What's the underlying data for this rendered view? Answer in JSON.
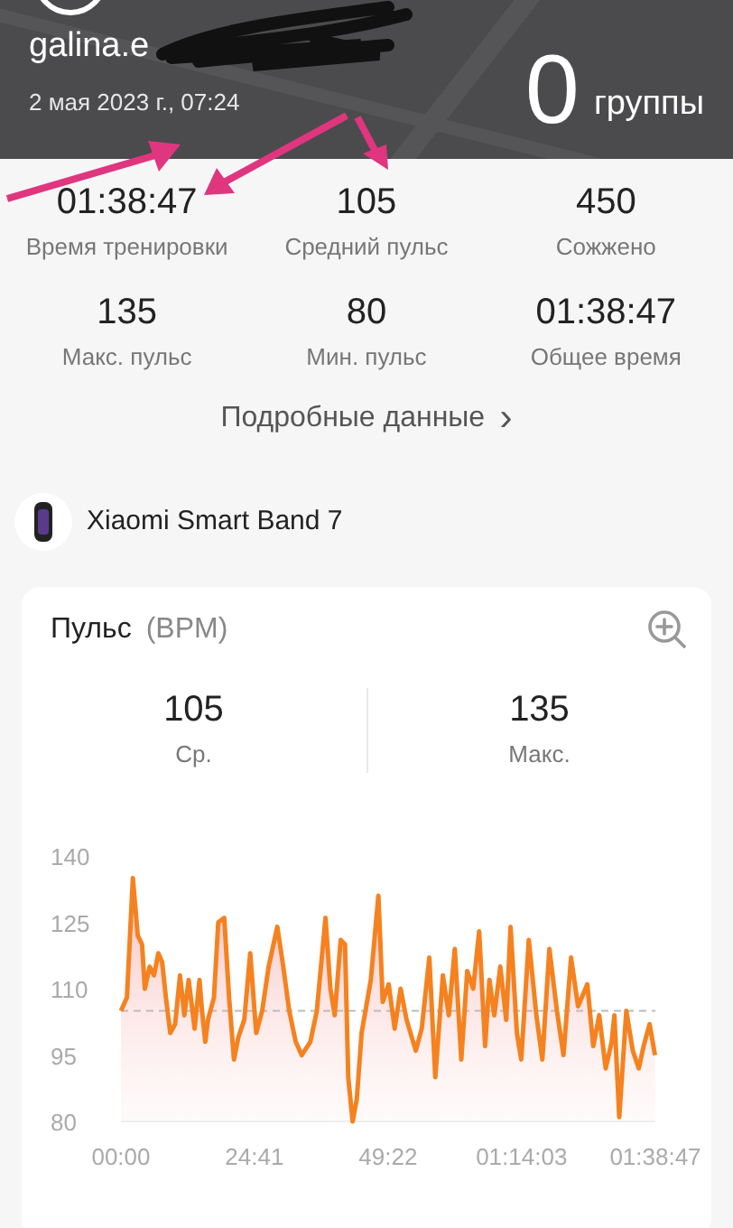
{
  "header": {
    "account": "galina.e",
    "date": "2 мая 2023 г., 07:24",
    "groups_count": "0",
    "groups_label": "группы"
  },
  "stats": [
    {
      "value": "01:38:47",
      "label": "Время тренировки"
    },
    {
      "value": "105",
      "label": "Средний пульс"
    },
    {
      "value": "450",
      "label": "Сожжено"
    },
    {
      "value": "135",
      "label": "Макс. пульс"
    },
    {
      "value": "80",
      "label": "Мин. пульс"
    },
    {
      "value": "01:38:47",
      "label": "Общее время"
    }
  ],
  "details_link": {
    "label": "Подробные данные",
    "chevron": "›"
  },
  "device": {
    "name": "Xiaomi Smart Band 7"
  },
  "pulse_card": {
    "title": "Пульс",
    "unit": "(BPM)",
    "summary": [
      {
        "value": "105",
        "label": "Ср."
      },
      {
        "value": "135",
        "label": "Макс."
      }
    ],
    "chart_data": {
      "type": "area",
      "series": [
        {
          "color": "#f5821f",
          "x": [
            0,
            1.1,
            2.2,
            3.1,
            3.9,
            4.4,
            5.3,
            6.1,
            6.9,
            7.6,
            8.3,
            9.1,
            10.0,
            10.9,
            11.7,
            12.5,
            13.1,
            13.6,
            14.5,
            15.0,
            15.6,
            16.1,
            17.2,
            18.0,
            19.1,
            20.0,
            20.9,
            21.7,
            22.8,
            23.9,
            25.0,
            26.1,
            27.3,
            28.9,
            30.0,
            31.1,
            32.3,
            33.4,
            35.0,
            36.2,
            37.8,
            38.7,
            39.5,
            40.6,
            41.4,
            42.0,
            42.8,
            43.6,
            44.5,
            46.2,
            47.6,
            48.4,
            49.5,
            50.6,
            51.7,
            52.8,
            54.5,
            55.6,
            57.0,
            58.1,
            59.5,
            60.6,
            61.7,
            62.9,
            64.0,
            65.1,
            66.2,
            67.3,
            68.1,
            69.0,
            70.1,
            71.2,
            72.0,
            73.2,
            74.0,
            75.4,
            76.8,
            77.9,
            79.2,
            80.6,
            81.8,
            83.2,
            84.5,
            86.2,
            87.3,
            88.4,
            89.6,
            90.7,
            91.2,
            92.1,
            93.4,
            94.6,
            95.7,
            96.6,
            97.7,
            98.7
          ],
          "values": [
            105,
            108,
            135,
            122,
            120,
            110,
            115,
            113,
            118,
            116,
            108,
            100,
            102,
            113,
            104,
            112,
            106,
            101,
            112,
            105,
            98,
            103,
            108,
            125,
            126,
            108,
            94,
            99,
            103,
            118,
            100,
            105,
            115,
            124,
            115,
            105,
            98,
            95,
            98,
            105,
            126,
            110,
            104,
            121,
            120,
            90,
            80,
            85,
            100,
            112,
            131,
            107,
            111,
            101,
            110,
            103,
            96,
            101,
            117,
            90,
            113,
            104,
            119,
            94,
            114,
            110,
            123,
            97,
            112,
            104,
            115,
            103,
            124,
            100,
            94,
            121,
            104,
            94,
            119,
            105,
            95,
            117,
            106,
            111,
            97,
            104,
            92,
            98,
            104,
            81,
            105,
            96,
            92,
            97,
            102,
            95
          ]
        }
      ],
      "xlim": [
        0,
        98.78
      ],
      "ylim": [
        80,
        140
      ],
      "xticks": [
        {
          "value": 0,
          "label": "00:00"
        },
        {
          "value": 24.68,
          "label": "24:41"
        },
        {
          "value": 49.37,
          "label": "49:22"
        },
        {
          "value": 74.05,
          "label": "01:14:03"
        },
        {
          "value": 98.78,
          "label": "01:38:47"
        }
      ],
      "yticks": [
        80,
        95,
        110,
        125,
        140
      ],
      "ref_lines": [
        {
          "axis": "y",
          "value": 105
        }
      ]
    }
  }
}
